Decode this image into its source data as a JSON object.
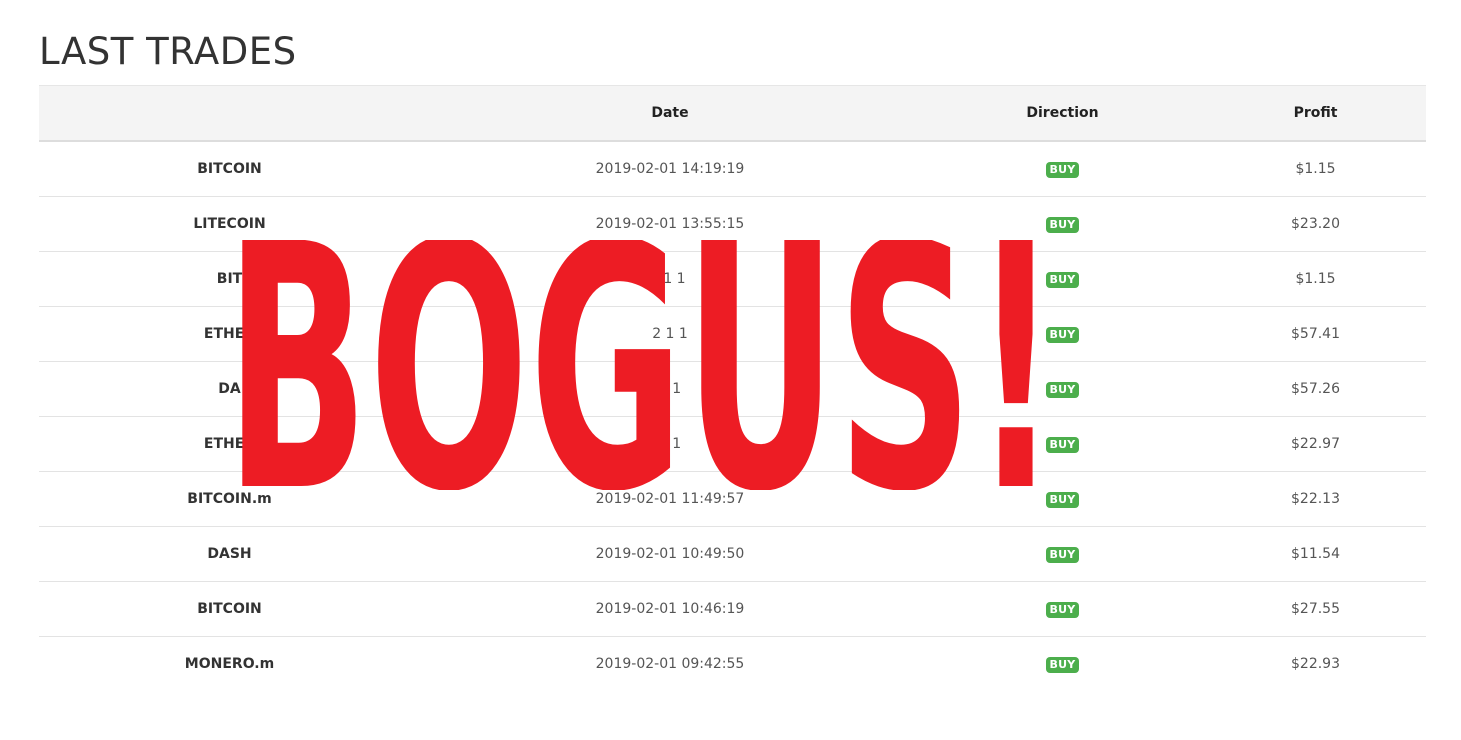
{
  "page": {
    "title": "LAST TRADES"
  },
  "table": {
    "columns": [
      "",
      "Date",
      "Direction",
      "Profit"
    ],
    "rows": [
      {
        "asset": "BITCOIN",
        "date": "2019-02-01 14:19:19",
        "direction": "BUY",
        "profit": "$1.15"
      },
      {
        "asset": "LITECOIN",
        "date": "2019-02-01 13:55:15",
        "direction": "BUY",
        "profit": "$23.20"
      },
      {
        "asset": "BIT",
        "date": "01 1",
        "direction": "BUY",
        "profit": "$1.15"
      },
      {
        "asset": "ETHER",
        "date": "2 1 1",
        "direction": "BUY",
        "profit": "$57.41"
      },
      {
        "asset": "DA",
        "date": "1 1",
        "direction": "BUY",
        "profit": "$57.26"
      },
      {
        "asset": "ETHER",
        "date": "1 1",
        "direction": "BUY",
        "profit": "$22.97"
      },
      {
        "asset": "BITCOIN.m",
        "date": "2019-02-01 11:49:57",
        "direction": "BUY",
        "profit": "$22.13"
      },
      {
        "asset": "DASH",
        "date": "2019-02-01 10:49:50",
        "direction": "BUY",
        "profit": "$11.54"
      },
      {
        "asset": "BITCOIN",
        "date": "2019-02-01 10:46:19",
        "direction": "BUY",
        "profit": "$27.55"
      },
      {
        "asset": "MONERO.m",
        "date": "2019-02-01 09:42:55",
        "direction": "BUY",
        "profit": "$22.93"
      }
    ]
  },
  "overlay": {
    "text": "BOGUS!",
    "color": "#ed1c24"
  },
  "colors": {
    "buy_badge": "#4cae4c",
    "header_bg": "#f4f4f4"
  }
}
